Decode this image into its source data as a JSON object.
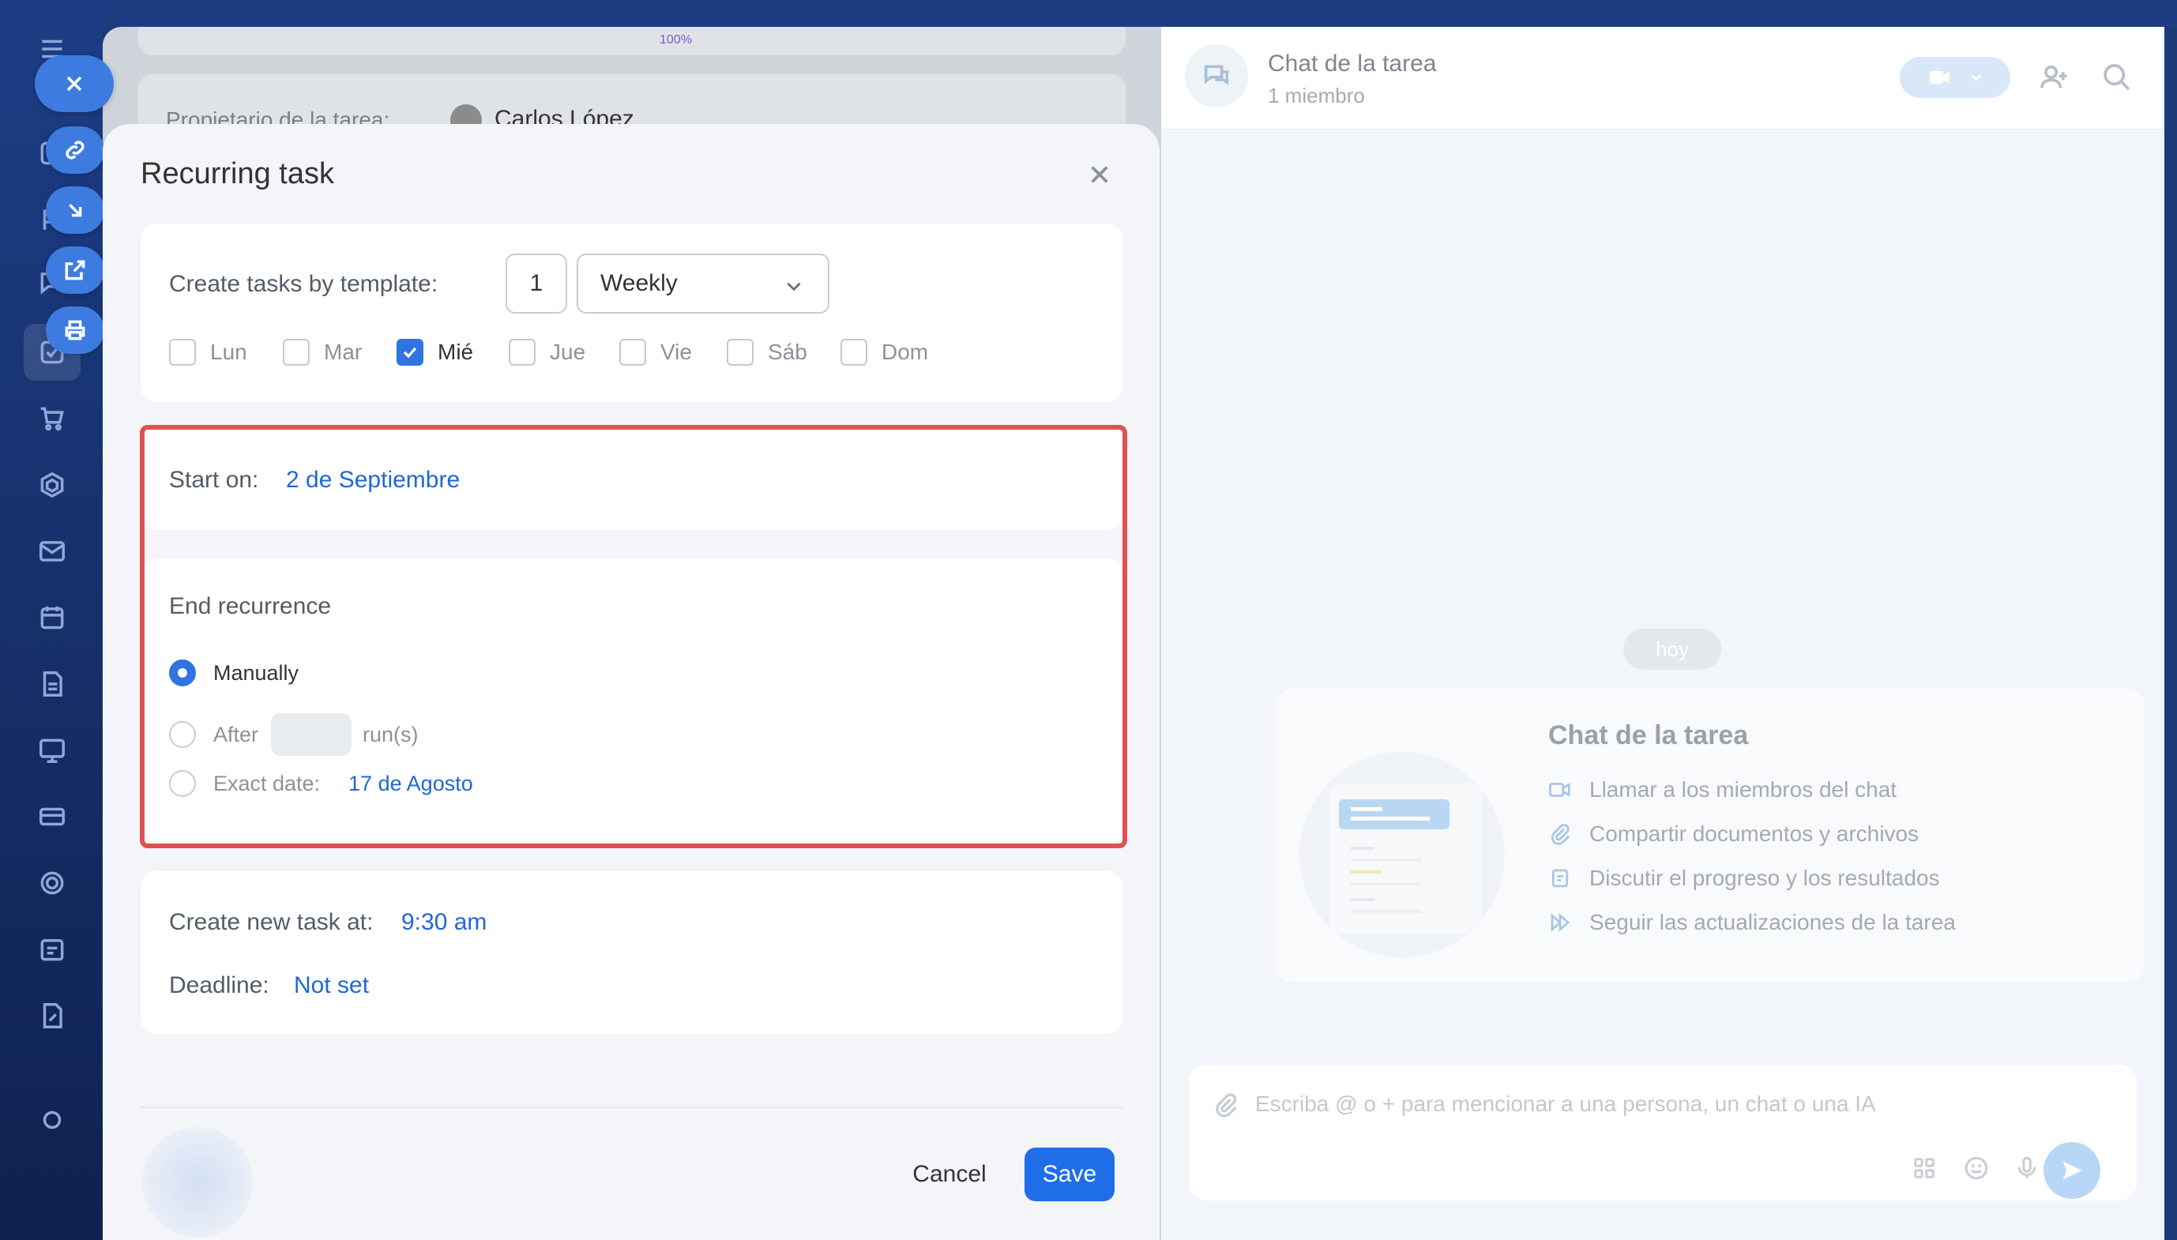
{
  "background": {
    "zoom_label": "100%",
    "owner_label": "Propietario de la tarea:",
    "owner_name": "Carlos López"
  },
  "dialog": {
    "title": "Recurring task",
    "template_label": "Create tasks by template:",
    "interval_value": "1",
    "frequency": "Weekly",
    "days": [
      {
        "label": "Lun",
        "checked": false
      },
      {
        "label": "Mar",
        "checked": false
      },
      {
        "label": "Mié",
        "checked": true
      },
      {
        "label": "Jue",
        "checked": false
      },
      {
        "label": "Vie",
        "checked": false
      },
      {
        "label": "Sáb",
        "checked": false
      },
      {
        "label": "Dom",
        "checked": false
      }
    ],
    "start_label": "Start on:",
    "start_value": "2 de Septiembre",
    "end_title": "End recurrence",
    "end_options": {
      "manually": "Manually",
      "after": "After",
      "runs": "run(s)",
      "exact": "Exact date:",
      "exact_value": "17 de Agosto"
    },
    "selected_end_option": "manually",
    "new_task_label": "Create new task at:",
    "new_task_value": "9:30 am",
    "deadline_label": "Deadline:",
    "deadline_value": "Not set",
    "cancel_label": "Cancel",
    "save_label": "Save"
  },
  "chat": {
    "title": "Chat de la tarea",
    "subtitle": "1 miembro",
    "date_badge": "hoy",
    "card_title": "Chat de la tarea",
    "features": [
      "Llamar a los miembros del chat",
      "Compartir documentos y archivos",
      "Discutir el progreso y los resultados",
      "Seguir las actualizaciones de la tarea"
    ],
    "input_placeholder": "Escriba @ o + para mencionar a una persona, un chat o una IA"
  },
  "colors": {
    "accent": "#2067d6",
    "save_button": "#1f6ee8",
    "highlight_border": "#e05252",
    "sidebar": "#1c3d86"
  }
}
